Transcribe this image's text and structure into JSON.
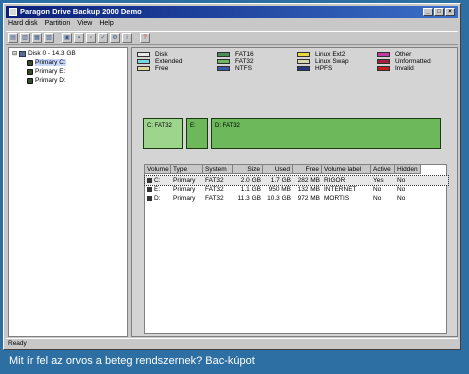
{
  "window": {
    "title": "Paragon Drive Backup 2000 Demo",
    "buttons": [
      "_",
      "□",
      "×"
    ]
  },
  "menu": [
    "Hard disk",
    "Partition",
    "View",
    "Help"
  ],
  "toolbar": {
    "icons": [
      "backup-icon",
      "restore-icon",
      "copy-icon",
      "compare-icon",
      "open-icon",
      "save-icon",
      "properties-icon",
      "check-icon",
      "settings-icon",
      "info-icon",
      "help-icon"
    ]
  },
  "tree": {
    "disk": "Disk 0 - 14.3 GB",
    "partitions": [
      "Primary C:",
      "Primary E:",
      "Primary D:"
    ]
  },
  "legend": [
    {
      "label": "Disk",
      "color": "#e8e8e8"
    },
    {
      "label": "Extended",
      "color": "#7ad6e0"
    },
    {
      "label": "Free",
      "color": "#d9d9a0"
    },
    {
      "label": "FAT16",
      "color": "#4a8a5a"
    },
    {
      "label": "FAT32",
      "color": "#6cb85a"
    },
    {
      "label": "NTFS",
      "color": "#3a5aa8"
    },
    {
      "label": "Linux Ext2",
      "color": "#e8d840"
    },
    {
      "label": "Linux Swap",
      "color": "#d8d8b0"
    },
    {
      "label": "HPFS",
      "color": "#283880"
    },
    {
      "label": "Other",
      "color": "#c03aa0"
    },
    {
      "label": "Unformatted",
      "color": "#a02040"
    },
    {
      "label": "Invalid",
      "color": "#c02020"
    }
  ],
  "map": [
    {
      "label": "C:  FAT32",
      "selected": true
    },
    {
      "label": "E:",
      "selected": false
    },
    {
      "label": "D:  FAT32",
      "selected": false
    }
  ],
  "table": {
    "headers": [
      "Volume",
      "Type",
      "System",
      "Size",
      "Used",
      "Free",
      "Volume label",
      "Active",
      "Hidden"
    ],
    "rows": [
      [
        "C:",
        "Primary",
        "FAT32",
        "2.0 GB",
        "1.7 GB",
        "282 MB",
        "RIGOR",
        "Yes",
        "No"
      ],
      [
        "E:",
        "Primary",
        "FAT32",
        "1.1 GB",
        "950 MB",
        "132 MB",
        "INTERNET",
        "No",
        "No"
      ],
      [
        "D:",
        "Primary",
        "FAT32",
        "11.3 GB",
        "10.3 GB",
        "972 MB",
        "MORTIS",
        "No",
        "No"
      ]
    ]
  },
  "status": "Ready",
  "caption": "Mit ír fel az orvos a beteg rendszernek? Bac-kúpot"
}
